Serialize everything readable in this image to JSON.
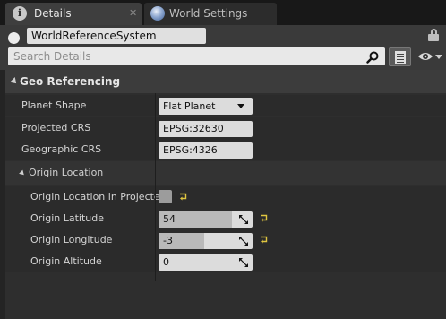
{
  "tabs": [
    {
      "label": "Details",
      "icon": "info-icon",
      "icon_glyph": "i"
    },
    {
      "label": "World Settings",
      "icon": "globe-icon"
    }
  ],
  "tab_close_glyph": "✕",
  "header": {
    "actor_name": "WorldReferenceSystem",
    "search_placeholder": "Search Details"
  },
  "category": {
    "label": "Geo Referencing"
  },
  "properties": {
    "planet_shape": {
      "label": "Planet Shape",
      "value": "Flat Planet"
    },
    "projected_crs": {
      "label": "Projected CRS",
      "value": "EPSG:32630"
    },
    "geographic_crs": {
      "label": "Geographic CRS",
      "value": "EPSG:4326"
    }
  },
  "origin": {
    "label": "Origin Location",
    "in_projected": {
      "label": "Origin Location in Projected",
      "checked": false
    },
    "latitude": {
      "label": "Origin Latitude",
      "value": "54",
      "slider_fraction": 0.78
    },
    "longitude": {
      "label": "Origin Longitude",
      "value": "-3",
      "slider_fraction": 0.49
    },
    "altitude": {
      "label": "Origin Altitude",
      "value": "0"
    }
  },
  "colors": {
    "reset_arrow": "#e0c640",
    "field_bg": "#dcdcdc",
    "panel_bg": "#2e2e2e"
  }
}
